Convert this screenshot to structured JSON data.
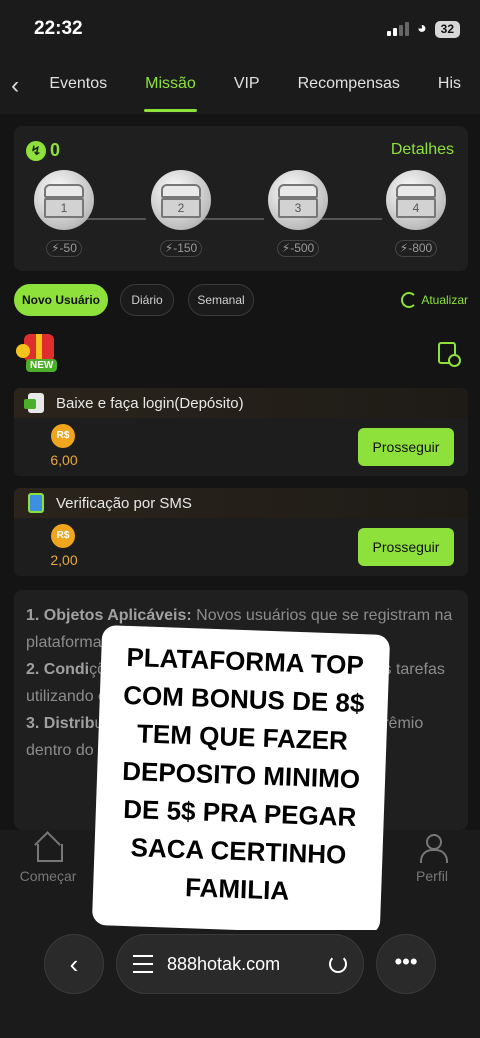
{
  "status": {
    "time": "22:32",
    "battery": "32"
  },
  "tabs": [
    "Eventos",
    "Missão",
    "VIP",
    "Recompensas",
    "His"
  ],
  "panel": {
    "score": "0",
    "details": "Detalhes",
    "chests": [
      {
        "num": "1",
        "cost": "-50"
      },
      {
        "num": "2",
        "cost": "-150"
      },
      {
        "num": "3",
        "cost": "-500"
      },
      {
        "num": "4",
        "cost": "-800"
      }
    ]
  },
  "filters": {
    "new_user": "Novo Usuário",
    "daily": "Diário",
    "weekly": "Semanal",
    "refresh": "Atualizar"
  },
  "badge": "NEW",
  "tasks": [
    {
      "title": "Baixe e faça login(Depósito)",
      "currency": "R$",
      "amount": "6,00",
      "button": "Prosseguir"
    },
    {
      "title": "Verificação por SMS",
      "currency": "R$",
      "amount": "2,00",
      "button": "Prosseguir"
    }
  ],
  "rules": {
    "p1_head": "1. Objetos Aplicáveis:",
    "p1_text": " Novos usuários que se registram na plataforma pela primeira vez.",
    "p2_head": "2. Condi",
    "p2_text": "ções: é necessário completar as seguintes tarefas utilizando o método de pagamento indicado.",
    "p3_head": "3. Distrib",
    "p3_text": "uição: após completar a tarefa, dev... o prêmio dentro do tempo esp..."
  },
  "nav": {
    "home": "Começar",
    "profile": "Perfil"
  },
  "sticker": "PLATAFORMA TOP COM BONUS DE 8$ TEM QUE FAZER DEPOSITO MINIMO DE 5$ PRA PEGAR SACA CERTINHO FAMILIA",
  "browser": {
    "url": "888hotak.com"
  },
  "colors": {
    "accent": "#8ee13a",
    "coin": "#f0a51e",
    "background": "#141414"
  }
}
